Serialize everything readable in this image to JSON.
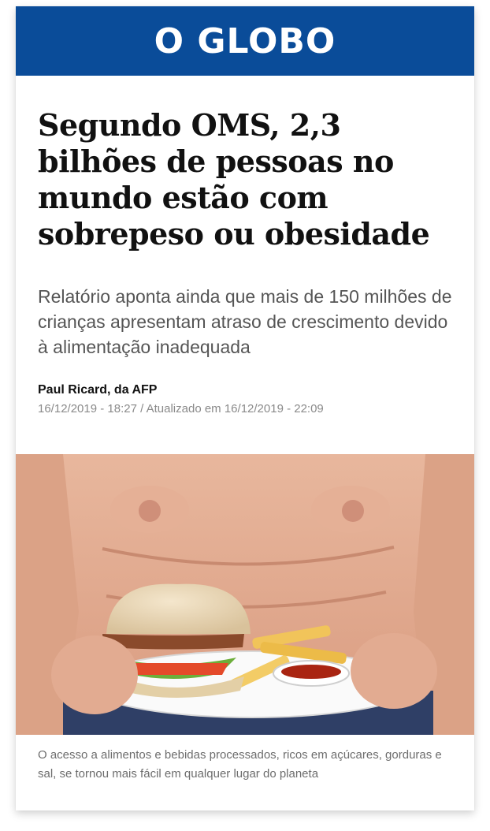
{
  "masthead": {
    "logo_text": "O GLOBO",
    "bg_color": "#0a4c99"
  },
  "article": {
    "headline": "Segundo OMS, 2,3 bilhões de pessoas no mundo estão com sobrepeso ou obesidade",
    "subheadline": "Relatório aponta ainda que mais de 150 milhões de crianças apresentam atraso de crescimento devido à alimentação inadequada",
    "byline": "Paul Ricard, da AFP",
    "dateline": "16/12/2019 - 18:27 / Atualizado em 16/12/2019 - 22:09"
  },
  "photo": {
    "caption": "O acesso a alimentos e bebidas processados, ricos em açúcares, gorduras e sal, se tornou mais fácil em qualquer lugar do planeta"
  }
}
